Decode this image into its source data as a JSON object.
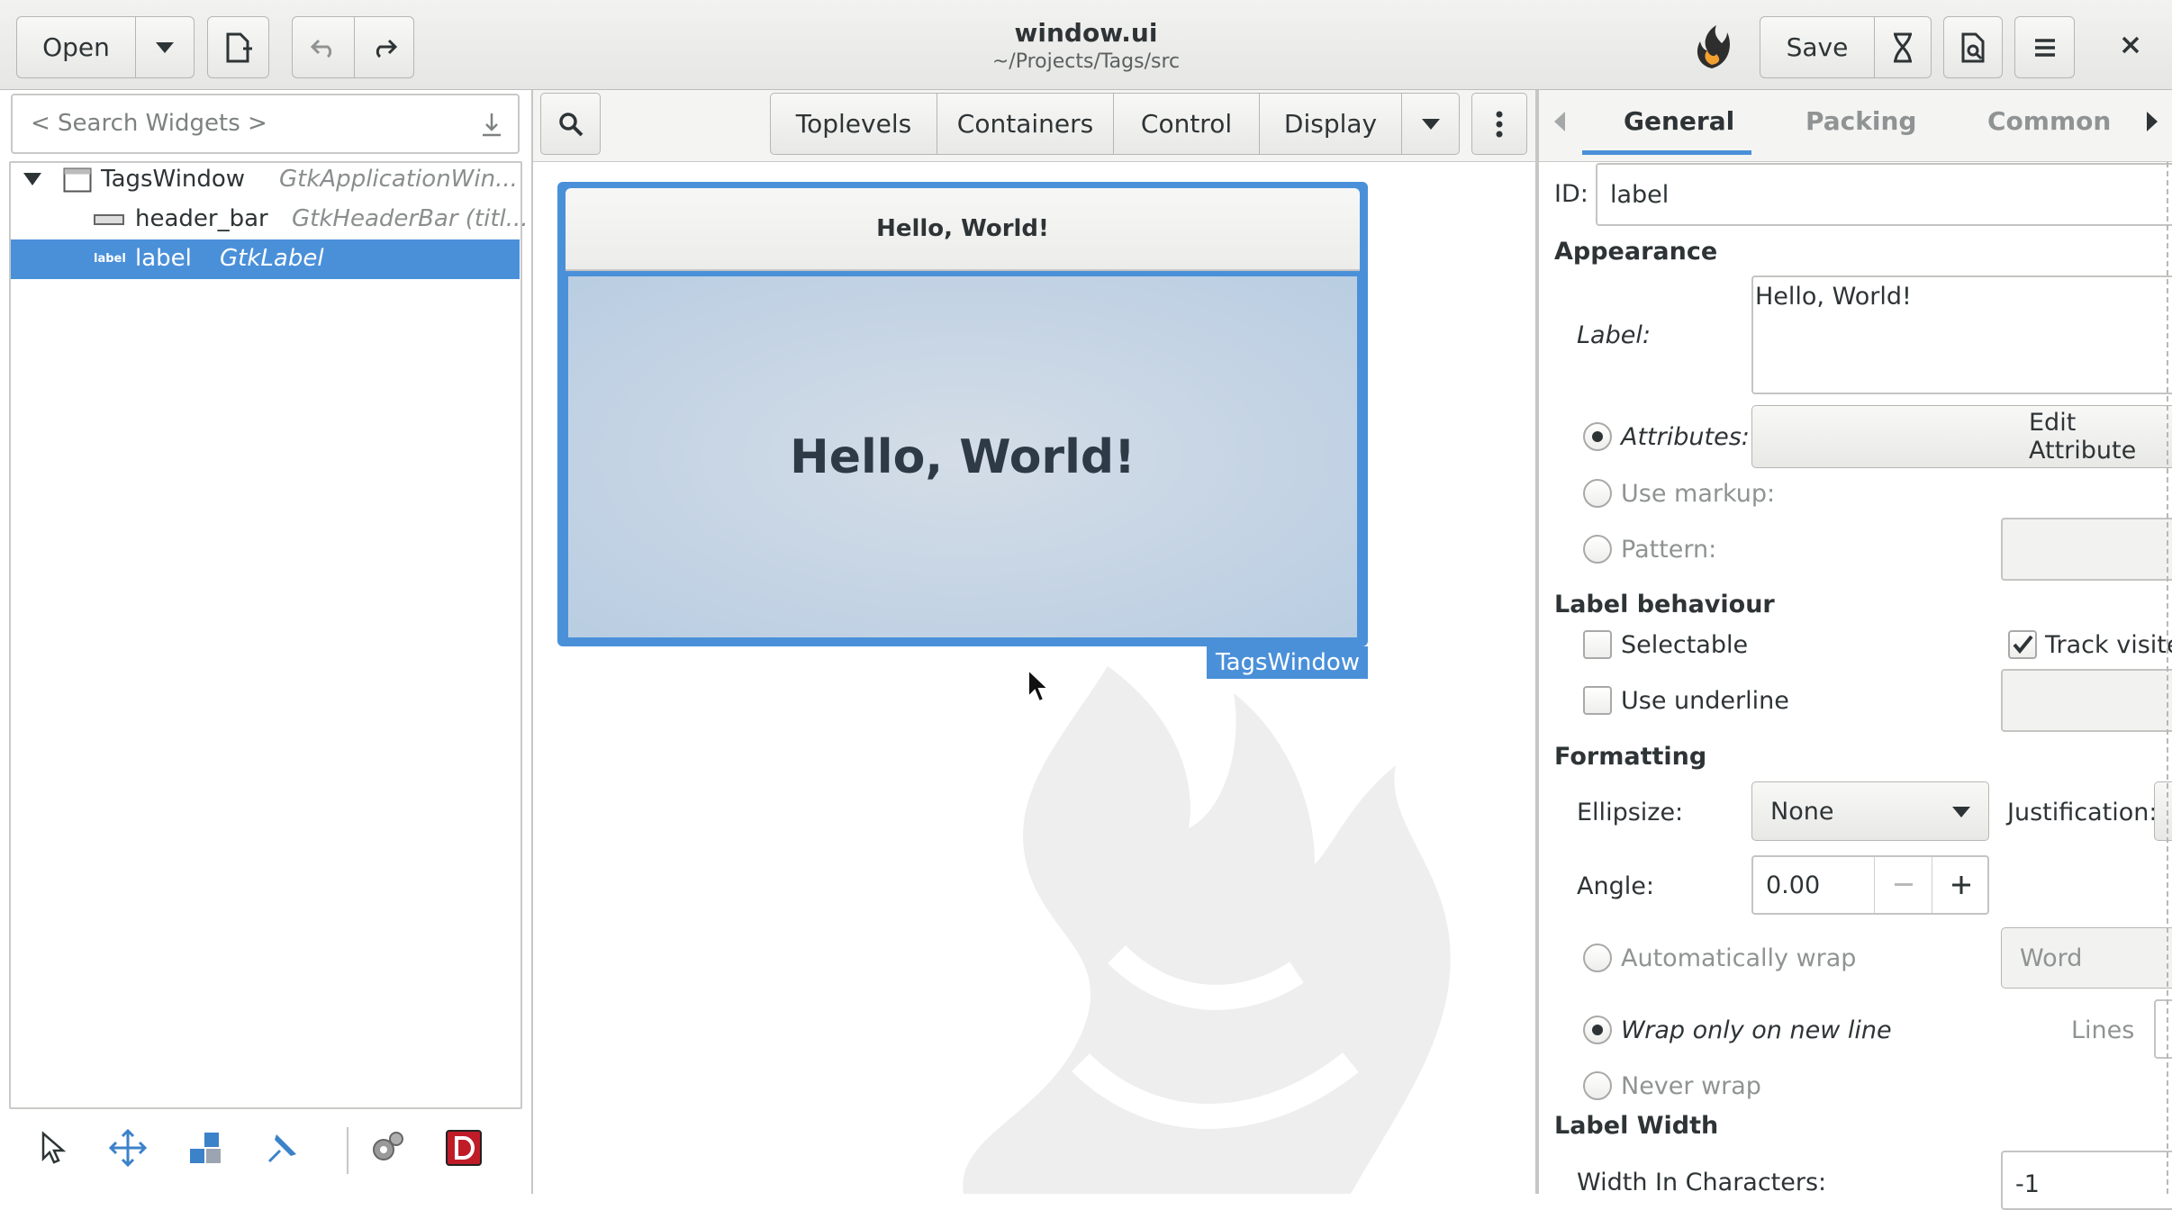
{
  "header": {
    "open_label": "Open",
    "title": "window.ui",
    "subtitle": "~/Projects/Tags/src",
    "save_label": "Save"
  },
  "widgets": {
    "search_placeholder": "< Search Widgets >",
    "tree": [
      {
        "name": "TagsWindow",
        "type": "GtkApplicationWin..."
      },
      {
        "name": "header_bar",
        "type": "GtkHeaderBar (titl..."
      },
      {
        "name": "label",
        "type": "GtkLabel"
      }
    ],
    "label_icon_text": "label"
  },
  "palette": {
    "groups": [
      "Toplevels",
      "Containers",
      "Control",
      "Display"
    ]
  },
  "preview": {
    "header_title": "Hello, World!",
    "label_text": "Hello, World!",
    "window_tag": "TagsWindow"
  },
  "inspector": {
    "tabs": [
      "General",
      "Packing",
      "Common"
    ],
    "active_tab": "General",
    "id_label": "ID:",
    "id_value": "label",
    "appearance": "Appearance",
    "label_label": "Label:",
    "label_value": "Hello, World!",
    "attributes_label": "Attributes:",
    "edit_attributes": "Edit Attribute",
    "use_markup": "Use markup:",
    "pattern": "Pattern:",
    "label_behaviour": "Label behaviour",
    "selectable": "Selectable",
    "track_visited": "Track visited",
    "use_underline": "Use underline",
    "formatting": "Formatting",
    "ellipsize_label": "Ellipsize:",
    "ellipsize_value": "None",
    "justification_label": "Justification:",
    "angle_label": "Angle:",
    "angle_value": "0.00",
    "auto_wrap": "Automatically wrap",
    "wrap_mode": "Word",
    "wrap_new_line": "Wrap only on new line",
    "lines_label": "Lines",
    "never_wrap": "Never wrap",
    "label_width": "Label Width",
    "width_chars_label": "Width In Characters:",
    "width_chars_value": "-1"
  },
  "colors": {
    "accent": "#4a90d9",
    "selection": "#4a90d9"
  }
}
